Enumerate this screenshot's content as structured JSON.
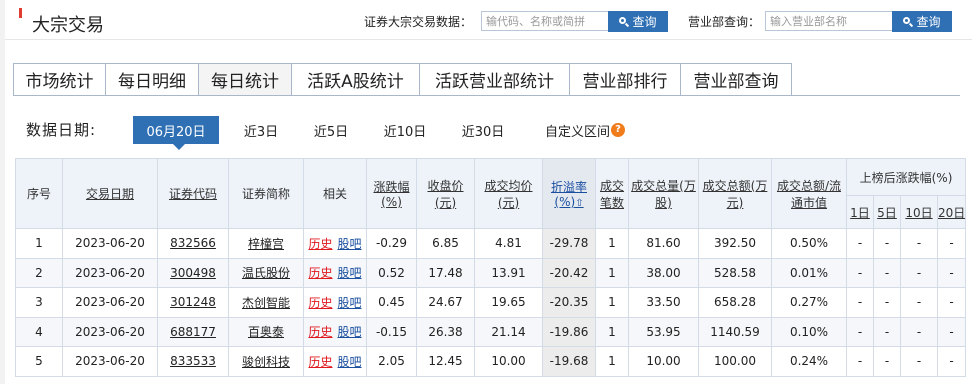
{
  "page": {
    "title": "大宗交易"
  },
  "search": {
    "stock_label": "证券大宗交易数据：",
    "stock_placeholder": "输代码、名称或简拼",
    "stock_button": "查询",
    "dept_label": "营业部查询：",
    "dept_placeholder": "输入营业部名称",
    "dept_button": "查询"
  },
  "tabs": [
    "市场统计",
    "每日明细",
    "每日统计",
    "活跃A股统计",
    "活跃营业部统计",
    "营业部排行",
    "营业部查询"
  ],
  "active_tab": "每日统计",
  "date_filter": {
    "label": "数据日期:",
    "options": [
      "06月20日",
      "近3日",
      "近5日",
      "近10日",
      "近30日",
      "自定义区间"
    ],
    "selected": "06月20日",
    "help": "?"
  },
  "table": {
    "headers": {
      "seq": "序号",
      "date": "交易日期",
      "code": "证券代码",
      "name": "证券简称",
      "related": "相关",
      "change_pct": "涨跌幅(%)",
      "close": "收盘价(元)",
      "avg_price": "成交均价(元)",
      "premium": "折溢率(%)",
      "count": "成交笔数",
      "volume": "成交总量(万股)",
      "amount": "成交总额(万元)",
      "ratio": "成交总额/流通市值",
      "after_group": "上榜后涨跌幅(%)",
      "d1": "1日",
      "d5": "5日",
      "d10": "10日",
      "d20": "20日"
    },
    "sort_arrow": "⇧",
    "links": {
      "history": "历史",
      "forum": "股吧"
    },
    "rows": [
      {
        "seq": "1",
        "date": "2023-06-20",
        "code": "832566",
        "name": "梓橦宫",
        "change": "-0.29",
        "change_dir": "down",
        "close": "6.85",
        "avg": "4.81",
        "premium": "-29.78",
        "count": "1",
        "volume": "81.60",
        "amount": "392.50",
        "ratio": "0.50%",
        "d1": "-",
        "d5": "-",
        "d10": "-",
        "d20": "-"
      },
      {
        "seq": "2",
        "date": "2023-06-20",
        "code": "300498",
        "name": "温氏股份",
        "change": "0.52",
        "change_dir": "up",
        "close": "17.48",
        "avg": "13.91",
        "premium": "-20.42",
        "count": "1",
        "volume": "38.00",
        "amount": "528.58",
        "ratio": "0.01%",
        "d1": "-",
        "d5": "-",
        "d10": "-",
        "d20": "-"
      },
      {
        "seq": "3",
        "date": "2023-06-20",
        "code": "301248",
        "name": "杰创智能",
        "change": "0.45",
        "change_dir": "up",
        "close": "24.67",
        "avg": "19.65",
        "premium": "-20.35",
        "count": "1",
        "volume": "33.50",
        "amount": "658.28",
        "ratio": "0.27%",
        "d1": "-",
        "d5": "-",
        "d10": "-",
        "d20": "-"
      },
      {
        "seq": "4",
        "date": "2023-06-20",
        "code": "688177",
        "name": "百奥泰",
        "change": "-0.15",
        "change_dir": "down",
        "close": "26.38",
        "avg": "21.14",
        "premium": "-19.86",
        "count": "1",
        "volume": "53.95",
        "amount": "1140.59",
        "ratio": "0.10%",
        "d1": "-",
        "d5": "-",
        "d10": "-",
        "d20": "-"
      },
      {
        "seq": "5",
        "date": "2023-06-20",
        "code": "833533",
        "name": "骏创科技",
        "change": "2.05",
        "change_dir": "up",
        "close": "12.45",
        "avg": "10.00",
        "premium": "-19.68",
        "count": "1",
        "volume": "10.00",
        "amount": "100.00",
        "ratio": "0.24%",
        "d1": "-",
        "d5": "-",
        "d10": "-",
        "d20": "-"
      }
    ]
  },
  "colors": {
    "accent": "#2f6fb4",
    "up": "#e0191e",
    "down": "#079a2f",
    "link": "#1a4fa0"
  }
}
